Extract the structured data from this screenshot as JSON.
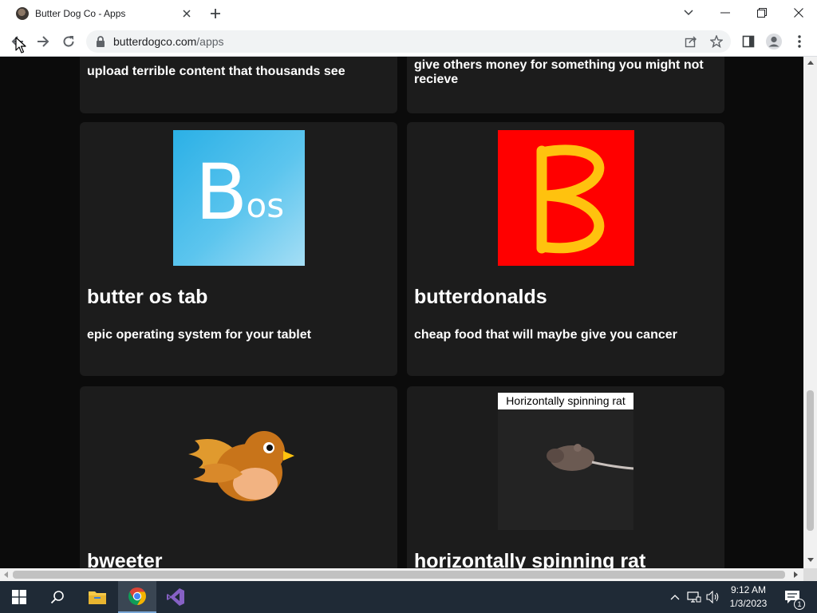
{
  "browser": {
    "tab_title": "Butter Dog Co - Apps",
    "url_domain": "butterdogco.com",
    "url_path": "/apps"
  },
  "apps": {
    "top_left_desc": "upload terrible content that thousands see",
    "top_right_desc": "give others money for something you might not recieve",
    "cards": [
      {
        "title": "butter os tab",
        "desc": "epic operating system for your tablet",
        "logo_b": "B",
        "logo_os": "os"
      },
      {
        "title": "butterdonalds",
        "desc": "cheap food that will maybe give you cancer"
      },
      {
        "title": "bweeter"
      },
      {
        "title": "horizontally spinning rat",
        "image_caption": "Horizontally spinning rat"
      }
    ]
  },
  "taskbar": {
    "time": "9:12 AM",
    "date": "1/3/2023",
    "notification_count": "1"
  },
  "colors": {
    "page_bg": "#0b0b0b",
    "card_bg": "#1c1c1c",
    "bos_blue": "#2bb0e6",
    "butterdonalds_red": "#ff0000",
    "butterdonalds_yellow": "#ffc20e",
    "bird_orange": "#c8741a"
  }
}
